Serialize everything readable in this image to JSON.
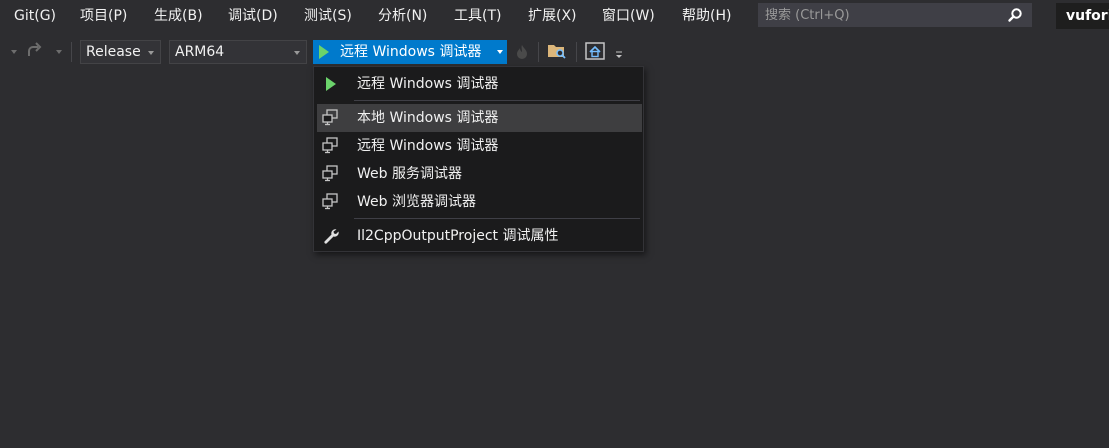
{
  "menubar": {
    "items": [
      "Git(G)",
      "项目(P)",
      "生成(B)",
      "调试(D)",
      "测试(S)",
      "分析(N)",
      "工具(T)",
      "扩展(X)",
      "窗口(W)",
      "帮助(H)"
    ],
    "search_placeholder": "搜索 (Ctrl+Q)",
    "solution_name": "vufori"
  },
  "toolbar": {
    "configuration": "Release",
    "platform": "ARM64",
    "run_label": "远程 Windows 调试器"
  },
  "dropdown": {
    "top_item": "远程 Windows 调试器",
    "items": [
      {
        "label": "本地 Windows 调试器",
        "icon": "computer-icon",
        "highlighted": true
      },
      {
        "label": "远程 Windows 调试器",
        "icon": "computer-icon",
        "highlighted": false
      },
      {
        "label": "Web 服务调试器",
        "icon": "computer-icon",
        "highlighted": false
      },
      {
        "label": "Web 浏览器调试器",
        "icon": "computer-icon",
        "highlighted": false
      }
    ],
    "properties_item": "Il2CppOutputProject 调试属性"
  },
  "colors": {
    "background": "#2d2d30",
    "accent": "#007acc",
    "menu_bg": "#1b1b1c",
    "highlight": "#3e3e40",
    "play_green": "#6bd36b"
  }
}
